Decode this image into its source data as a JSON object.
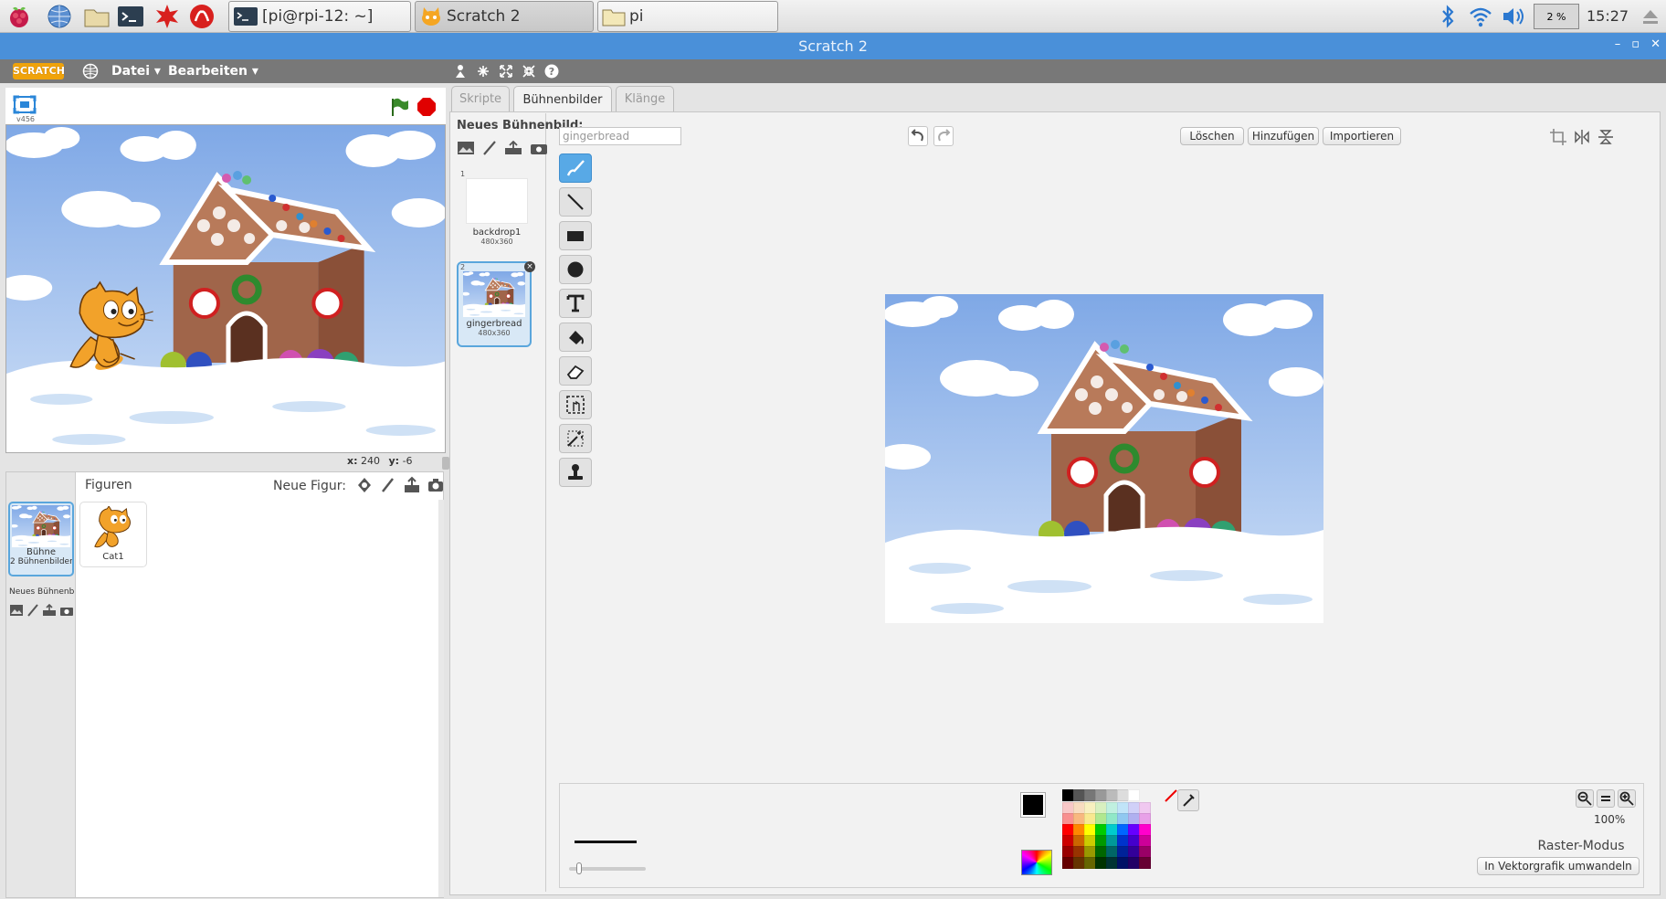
{
  "taskbar": {
    "tasks": [
      {
        "label": "[pi@rpi-12: ~]"
      },
      {
        "label": "Scratch 2"
      },
      {
        "label": "pi"
      }
    ],
    "cpu": "2 %",
    "clock": "15:27"
  },
  "window": {
    "title": "Scratch 2"
  },
  "menubar": {
    "logo": "SCRATCH",
    "menus": [
      "Datei ▾",
      "Bearbeiten ▾"
    ]
  },
  "stage": {
    "version": "v456",
    "x_label": "x:",
    "x_value": "240",
    "y_label": "y:",
    "y_value": "-6"
  },
  "sprites": {
    "title": "Figuren",
    "new_sprite_label": "Neue Figur:",
    "stage_name": "Bühne",
    "stage_count": "2 Bühnenbilder",
    "new_backdrop_label": "Neues Bühnenbild:",
    "items": [
      {
        "name": "Cat1"
      }
    ]
  },
  "tabs": [
    "Skripte",
    "Bühnenbilder",
    "Klänge"
  ],
  "costumes": {
    "new_label": "Neues Bühnenbild:",
    "name_field": "gingerbread",
    "items": [
      {
        "index": "1",
        "name": "backdrop1",
        "size": "480x360"
      },
      {
        "index": "2",
        "name": "gingerbread",
        "size": "480x360"
      }
    ]
  },
  "editor": {
    "buttons": [
      "Löschen",
      "Hinzufügen",
      "Importieren"
    ],
    "zoom": "100%",
    "mode_label": "Raster-Modus",
    "convert_button": "In Vektorgrafik umwandeln"
  },
  "icons": [
    "raspberry-menu-icon",
    "browser-icon",
    "file-manager-icon",
    "terminal-icon",
    "mathematica-icon",
    "wolfram-icon",
    "bluetooth-icon",
    "wifi-icon",
    "volume-icon",
    "eject-icon",
    "globe-icon",
    "green-flag-icon",
    "stop-icon",
    "brush-icon",
    "line-icon",
    "rectangle-icon",
    "ellipse-icon",
    "text-icon",
    "fill-icon",
    "eraser-icon",
    "select-icon",
    "magic-select-icon",
    "stamp-icon"
  ],
  "colors": {
    "accent": "#4a90d9",
    "selected": "#58a9e6",
    "stop": "#e00000",
    "flag": "#3a8a2a"
  }
}
